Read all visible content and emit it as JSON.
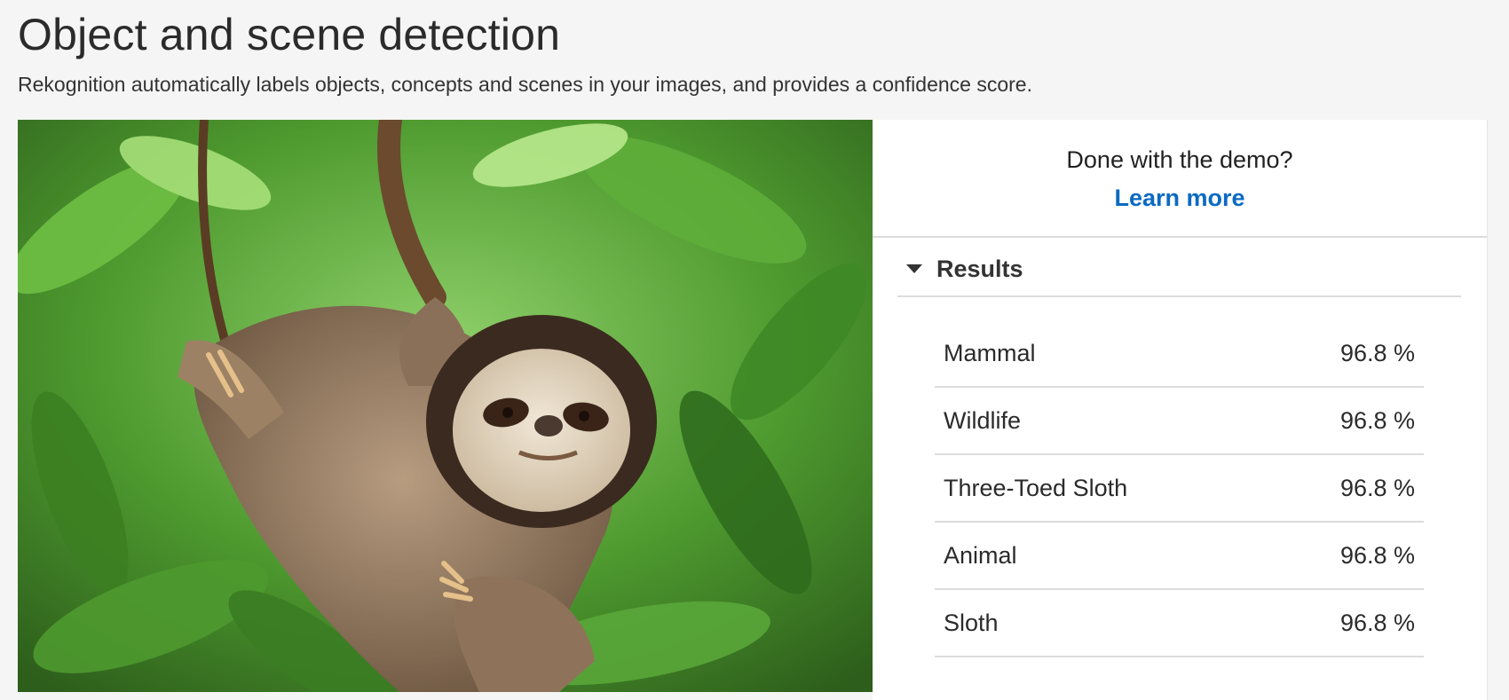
{
  "header": {
    "title": "Object and scene detection",
    "subtitle": "Rekognition automatically labels objects, concepts and scenes in your images, and provides a confidence score."
  },
  "image": {
    "description_icon": "sloth-photo"
  },
  "panel": {
    "demo_question": "Done with the demo?",
    "learn_more_label": "Learn more",
    "results_label": "Results",
    "results": [
      {
        "label": "Mammal",
        "confidence": "96.8 %"
      },
      {
        "label": "Wildlife",
        "confidence": "96.8 %"
      },
      {
        "label": "Three-Toed Sloth",
        "confidence": "96.8 %"
      },
      {
        "label": "Animal",
        "confidence": "96.8 %"
      },
      {
        "label": "Sloth",
        "confidence": "96.8 %"
      }
    ]
  },
  "colors": {
    "link": "#0b6ac3",
    "background": "#f5f5f5",
    "divider": "#dcdcdc"
  }
}
